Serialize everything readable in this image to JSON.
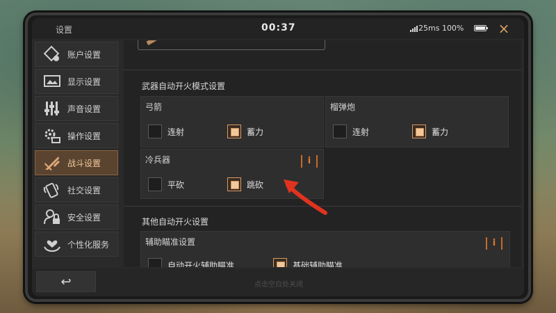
{
  "status": {
    "title": "设置",
    "time": "00:37",
    "ping": "25ms 100%",
    "close_icon": "×"
  },
  "sidebar": {
    "items": [
      {
        "label": "账户设置",
        "icon": "account-icon"
      },
      {
        "label": "显示设置",
        "icon": "display-icon"
      },
      {
        "label": "声音设置",
        "icon": "sound-icon"
      },
      {
        "label": "操作设置",
        "icon": "controls-icon"
      },
      {
        "label": "战斗设置",
        "icon": "combat-icon",
        "active": true
      },
      {
        "label": "社交设置",
        "icon": "social-icon"
      },
      {
        "label": "安全设置",
        "icon": "security-icon"
      },
      {
        "label": "个性化服务",
        "icon": "personalization-icon"
      }
    ]
  },
  "main": {
    "weapon_section_title": "武器自动开火模式设置",
    "bow": {
      "title": "弓箭",
      "options": [
        {
          "label": "连射",
          "checked": false
        },
        {
          "label": "蓄力",
          "checked": true
        }
      ]
    },
    "grenade_launcher": {
      "title": "榴弹炮",
      "options": [
        {
          "label": "连射",
          "checked": false
        },
        {
          "label": "蓄力",
          "checked": true
        }
      ]
    },
    "melee": {
      "title": "冷兵器",
      "info": "i",
      "options": [
        {
          "label": "平砍",
          "checked": false
        },
        {
          "label": "跳砍",
          "checked": true
        }
      ]
    },
    "other_section_title": "其他自动开火设置",
    "aim_assist": {
      "title": "辅助瞄准设置",
      "info": "i",
      "options": [
        {
          "label": "自动开火辅助瞄准",
          "checked": false
        },
        {
          "label": "基础辅助瞄准",
          "checked": true
        }
      ]
    }
  },
  "footer": {
    "back_icon": "↩",
    "hint": "点击空白处关闭"
  },
  "colors": {
    "accent": "#d79b66",
    "active_tab": "#5a4430",
    "arrow": "#e0331f"
  }
}
